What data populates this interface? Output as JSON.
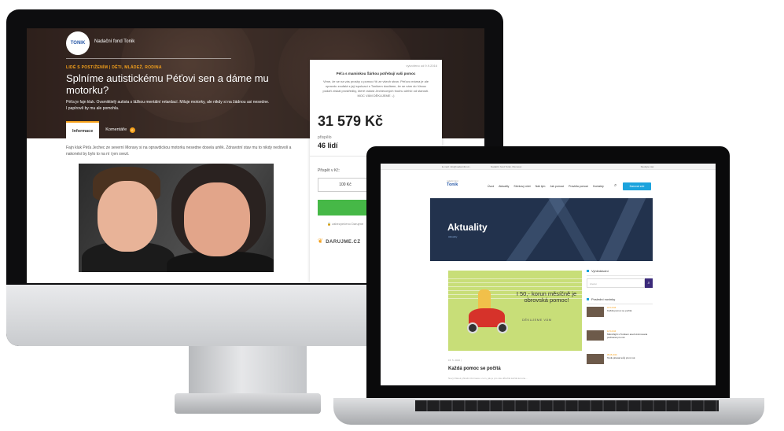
{
  "imac": {
    "org_logo": "TONIK",
    "org_name": "Nadační fond Tonik",
    "categories": "LIDÉ S POSTIŽENÍM | DĚTI, MLÁDEŽ, RODINA",
    "title": "Splníme autistickému Péťovi sen a dáme mu motorku?",
    "description": "Péťa je fajn kluk. Ovsmiktielý autista s lážkou mentální retardací. Miluje motorky, ale nikdy si na žádnou asi nesedne. I papírově by mu ale pomohla.",
    "tabs": [
      {
        "label": "Informace"
      },
      {
        "label": "Komentáře",
        "badge": "0"
      }
    ],
    "body_text": "Fajn kluk Péťa Jechec ze severní Moravy si na opravdickou motorku nesedne dosela urtěk. Zdravotní stav mu to nikdy nedovolí a nakonési by bylo to na ní i jen svezt.",
    "panel": {
      "date": "vytvořeno od 9.9.2016",
      "heading": "Péťa s maminkou Šárkou potřebují vaši pomoc",
      "message": "Vime, že se na vás prosby o pomoc řítí ze všech stran. Péťovo máma je ale opravdu zoufalá s její spoluací s Tonikem doufáme, že se nám do Vánoc podaří získat prostředky, které radost Jechecových trochu ulehčí od starostí. MOC VÁM DĚKUJEME :-)",
      "amount": "31 579 Kč",
      "contrib_label": "přispělo",
      "contrib_count": "46 lidí",
      "give_label": "Přispět v Kč:",
      "amount_option": "100 Kč",
      "secure_text": "zabezpečeno Darujme",
      "darujme_logo": "DARUJME.CZ"
    }
  },
  "macbook": {
    "topbar_left": "E-mail: info@nadacnifond...",
    "topbar_mid": "Nadační fond Tonik, Olomouc",
    "topbar_right": "Sledujte nás:",
    "logo_small": "nadační fond",
    "logo": "Tonik",
    "menu": [
      "Úvod",
      "Aktuality",
      "Sbírkový účet",
      "Náš tým",
      "Jak pomoci",
      "Pravidla pomoci",
      "Kontakty"
    ],
    "cta_label": "Darovat zde",
    "hero_title": "Aktuality",
    "hero_breadcrumb": "Aktuality",
    "banner_text": "I 50,- korun měsíčně je obrovská pomoc!",
    "banner_sub": "DĚKUJEME VÁM",
    "post_date": "15. 5. 2016 |",
    "post_title": "Každá pomoc se počítá",
    "post_excerpt": "Nový článek přináší informace o tom, jak je pro nás důležitá každá koruna...",
    "sidebar": {
      "search_heading": "Vyhledávání",
      "search_placeholder": "Hledat",
      "news_heading": "Poslední novinky",
      "news": [
        {
          "date": "18.5.2016",
          "title": "Každá pomoc se počítá"
        },
        {
          "date": "12.5.2016",
          "title": "Mikroflight s Tonikem aneb Animovaná podívaná pro rok"
        },
        {
          "date": "05.05.2016",
          "title": "Tonik přestal svůj první rok"
        }
      ]
    }
  }
}
